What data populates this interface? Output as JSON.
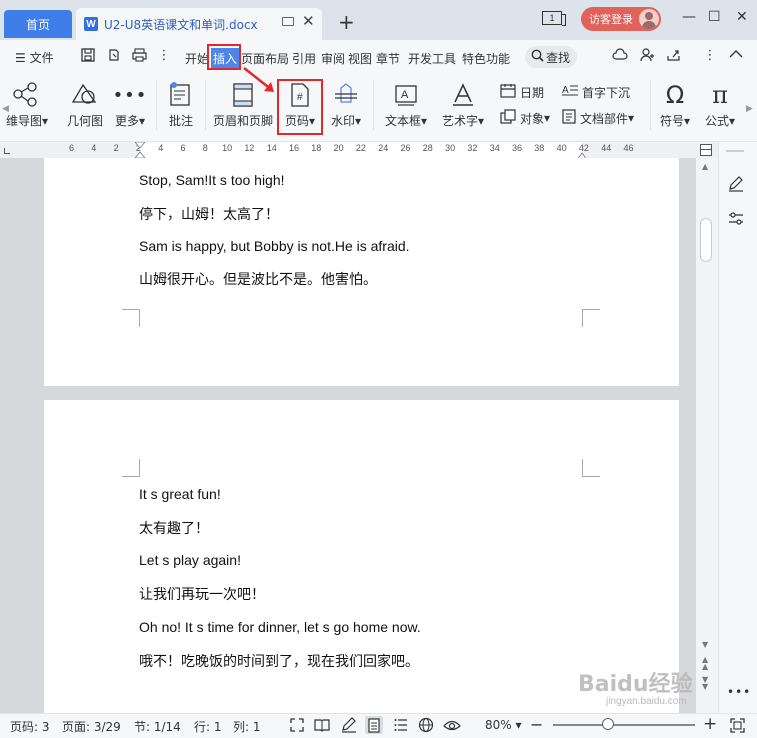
{
  "titlebar": {
    "home_tab": "首页",
    "doc_tab_title": "U2-U8英语课文和单词.docx",
    "w_letter": "W",
    "pages_count": "1",
    "visitor_label": "访客登录"
  },
  "menu": {
    "file": "文件",
    "items": [
      "开始",
      "插入",
      "页面布局",
      "引用",
      "审阅",
      "视图",
      "章节",
      "开发工具",
      "特色功能"
    ],
    "search": "查找"
  },
  "ribbon": {
    "mindmap": "维导图",
    "geometry": "几何图",
    "more": "更多",
    "comment": "批注",
    "header_footer": "页眉和页脚",
    "page_number": "页码",
    "watermark": "水印",
    "textbox": "文本框",
    "wordart": "艺术字",
    "date": "日期",
    "object": "对象",
    "dropcap": "首字下沉",
    "doc_parts": "文档部件",
    "symbol": "符号",
    "formula": "公式"
  },
  "ruler": {
    "ticks": [
      "6",
      "4",
      "2",
      "2",
      "4",
      "6",
      "8",
      "10",
      "12",
      "14",
      "16",
      "18",
      "20",
      "22",
      "24",
      "26",
      "28",
      "30",
      "32",
      "34",
      "36",
      "38",
      "40",
      "42",
      "44",
      "46"
    ]
  },
  "document": {
    "page1_lines": [
      "Stop, Sam!It s   too high!",
      "停下，山姆！太高了！",
      "Sam is happy, but Bobby is not.He is afraid.",
      "山姆很开心。但是波比不是。他害怕。"
    ],
    "page2_lines": [
      "It s great fun!",
      "太有趣了！",
      "Let s play again!",
      "让我们再玩一次吧！",
      "Oh no! It s time for dinner, let s go home now.",
      "哦不！吃晚饭的时间到了，现在我们回家吧。"
    ]
  },
  "status": {
    "page_num": "页码: 3",
    "page_of": "页面: 3/29",
    "section": "节: 1/14",
    "row": "行: 1",
    "col": "列: 1",
    "zoom": "80%"
  },
  "watermark": {
    "brand": "Baidu经验",
    "url": "jingyan.baidu.com"
  },
  "colors": {
    "accent": "#3f7ee8",
    "highlight": "#e02a2a",
    "visitor": "#e0625a"
  }
}
